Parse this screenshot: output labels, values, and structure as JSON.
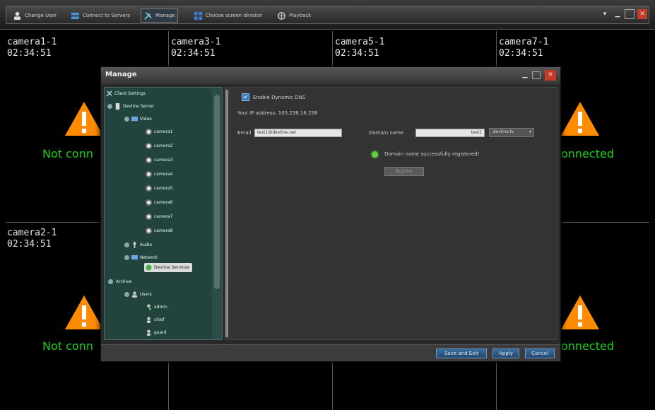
{
  "toolbar": {
    "change_user": "Change User",
    "connect_to_servers": "Connect to Servers",
    "manage": "Manage",
    "choose_screen_division": "Choose screen division",
    "playback": "Playback"
  },
  "cameras": [
    {
      "name": "camera1-1",
      "time": "02:34:51"
    },
    {
      "name": "camera3-1",
      "time": "02:34:51"
    },
    {
      "name": "camera5-1",
      "time": "02:34:51"
    },
    {
      "name": "camera7-1",
      "time": "02:34:51"
    },
    {
      "name": "camera2-1",
      "time": "02:34:51"
    }
  ],
  "status": {
    "not_connected_left": "Not conn",
    "connected_right": "onnected"
  },
  "dialog": {
    "title": "Manage",
    "tree": {
      "client_settings": "Client Settings",
      "server": "Devline Server",
      "video": "Video",
      "cameras": [
        "camera1",
        "camera2",
        "camera3",
        "camera4",
        "camera5",
        "camera6",
        "camera7",
        "camera8"
      ],
      "audio": "Audio",
      "network": "Network",
      "devline_services": "Devline Services",
      "archive": "Archive",
      "users": "Users",
      "user_list": [
        "admin",
        "chief",
        "guard"
      ]
    },
    "ddns": {
      "enable_label": "Enable Dynamic DNS",
      "ip_label": "Your IP address: 103.238.16.238",
      "email_label": "Email",
      "email_value": "test1@devline.net",
      "domain_label": "Domain name",
      "domain_value": "test1",
      "domain_suffix": ".devline.tv",
      "success_msg": "Domain name successfully registered!",
      "register_button": "Register"
    },
    "buttons": {
      "save_exit": "Save and Exit",
      "apply": "Apply",
      "cancel": "Cancel"
    }
  }
}
